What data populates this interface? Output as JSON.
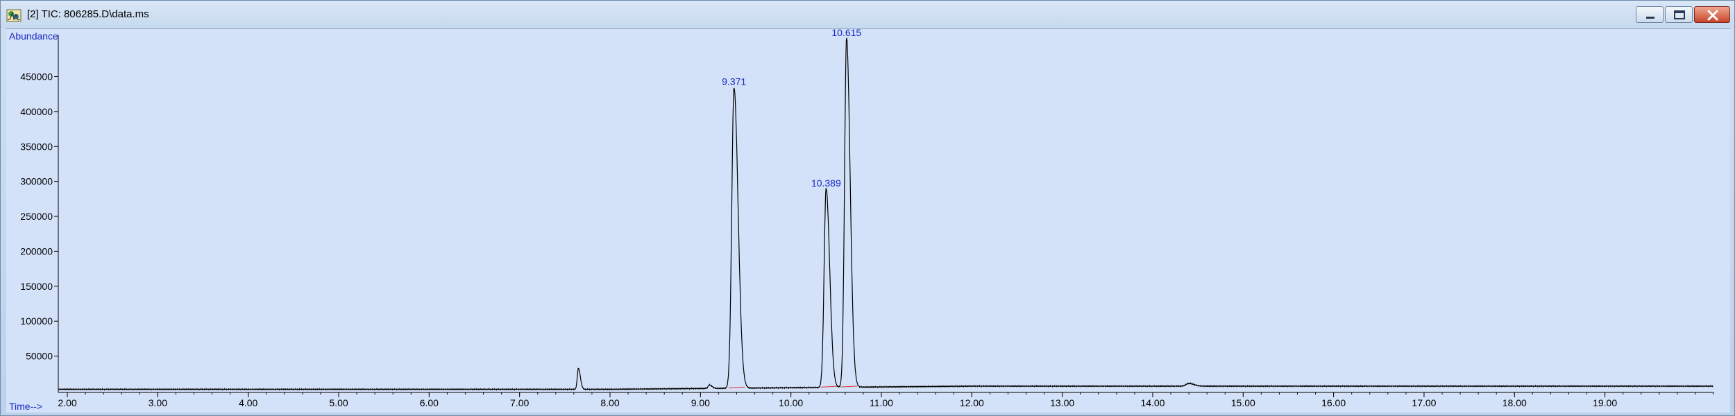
{
  "window": {
    "title": "[2] TIC: 806285.D\\data.ms"
  },
  "icons": {
    "app": "chromatogram-app-icon",
    "minimize": "minimize-icon",
    "maximize": "restore-icon",
    "close": "close-icon"
  },
  "colors": {
    "plot_background": "#d3e2f8",
    "trace": "#000000",
    "baseline": "#e03030",
    "label_text": "#1a28c7"
  },
  "chart_data": {
    "type": "line",
    "ylabel": "Abundance",
    "xlabel": "Time-->",
    "xlim": [
      1.9,
      20.2
    ],
    "ylim": [
      0,
      510000
    ],
    "x_ticks": [
      "2.00",
      "3.00",
      "4.00",
      "5.00",
      "6.00",
      "7.00",
      "8.00",
      "9.00",
      "10.00",
      "11.00",
      "12.00",
      "13.00",
      "14.00",
      "15.00",
      "16.00",
      "17.00",
      "18.00",
      "19.00"
    ],
    "y_ticks": [
      "50000",
      "100000",
      "150000",
      "200000",
      "250000",
      "300000",
      "350000",
      "400000",
      "450000"
    ],
    "peaks": [
      {
        "label": "9.371",
        "x": 9.371,
        "y": 430000,
        "width": 0.025
      },
      {
        "label": "10.389",
        "x": 10.389,
        "y": 285000,
        "width": 0.022
      },
      {
        "label": "10.615",
        "x": 10.615,
        "y": 500000,
        "width": 0.022
      }
    ],
    "minor_peaks": [
      {
        "x": 7.65,
        "y": 30000,
        "width": 0.012
      },
      {
        "x": 9.1,
        "y": 5000,
        "width": 0.015
      },
      {
        "x": 14.4,
        "y": 4000,
        "width": 0.03
      }
    ],
    "baseline": 2500,
    "baseline_end": 7000
  }
}
